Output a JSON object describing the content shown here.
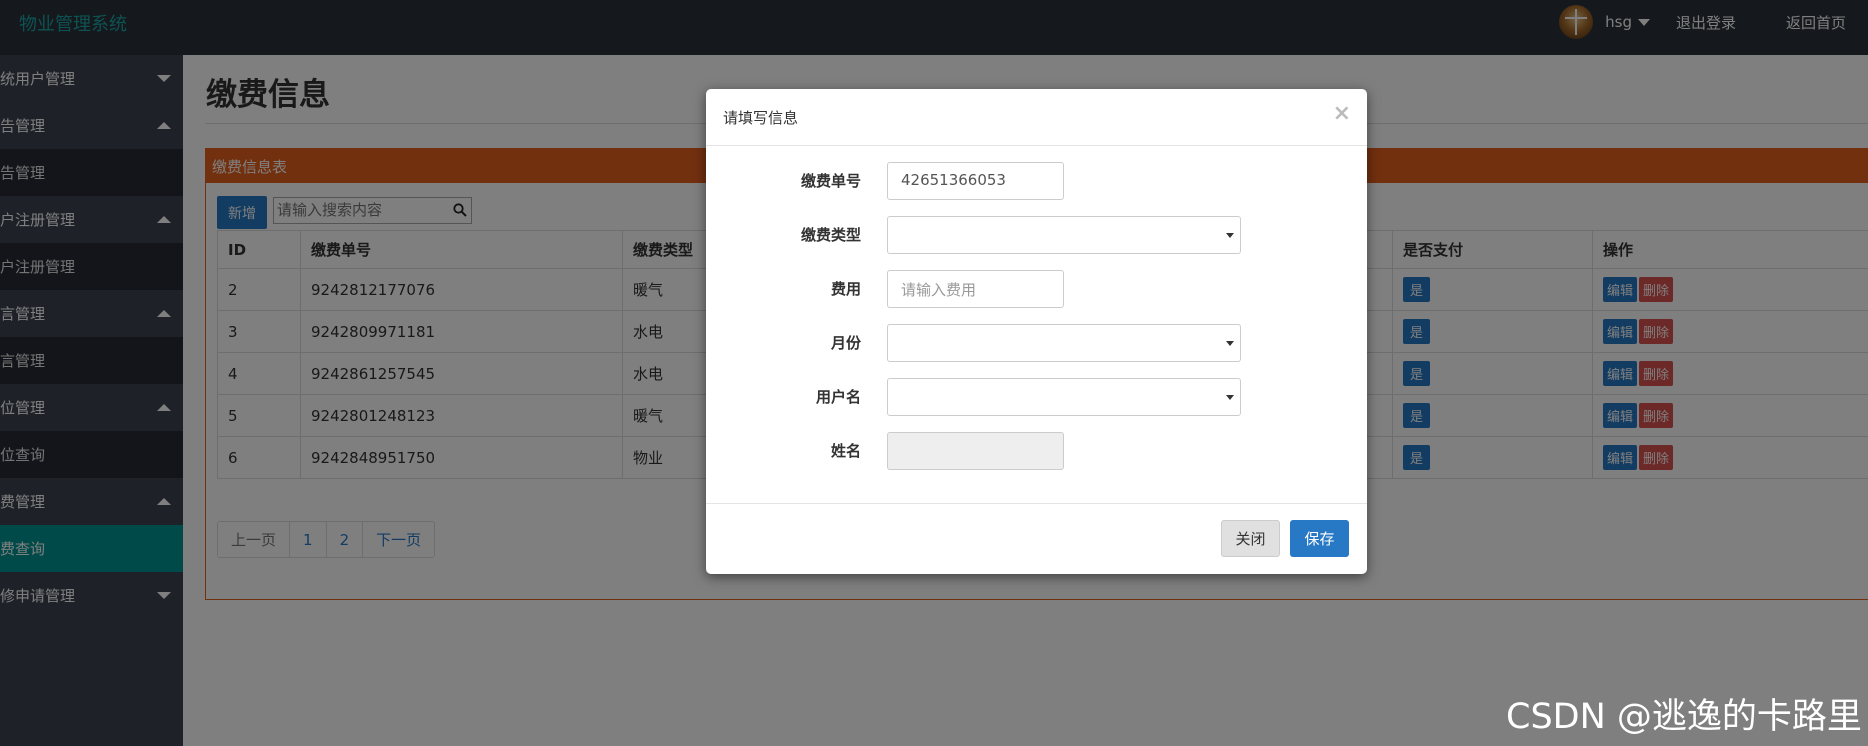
{
  "app": {
    "brand": "物业管理系统"
  },
  "topbar": {
    "username": "hsg",
    "logout": "退出登录",
    "home": "返回首页"
  },
  "sidebar": {
    "items": [
      {
        "label": "统用户管理",
        "type": "head",
        "expanded": false
      },
      {
        "label": "告管理",
        "type": "head",
        "expanded": true
      },
      {
        "label": "告管理",
        "type": "sub"
      },
      {
        "label": "户注册管理",
        "type": "head",
        "expanded": true
      },
      {
        "label": "户注册管理",
        "type": "sub"
      },
      {
        "label": "言管理",
        "type": "head",
        "expanded": true
      },
      {
        "label": "言管理",
        "type": "sub"
      },
      {
        "label": "位管理",
        "type": "head",
        "expanded": true
      },
      {
        "label": "位查询",
        "type": "sub"
      },
      {
        "label": "费管理",
        "type": "head",
        "expanded": true
      },
      {
        "label": "费查询",
        "type": "sub",
        "active": true
      },
      {
        "label": "修申请管理",
        "type": "head",
        "expanded": false
      }
    ]
  },
  "main": {
    "title": "缴费信息",
    "panel_title": "缴费信息表",
    "new_button": "新增",
    "search_placeholder": "请输入搜索内容",
    "columns": [
      "ID",
      "缴费单号",
      "缴费类型",
      "是否支付",
      "操作"
    ],
    "rows": [
      {
        "id": "2",
        "no": "9242812177076",
        "type": "暖气",
        "paid": "是"
      },
      {
        "id": "3",
        "no": "9242809971181",
        "type": "水电",
        "paid": "是"
      },
      {
        "id": "4",
        "no": "9242861257545",
        "type": "水电",
        "paid": "是"
      },
      {
        "id": "5",
        "no": "9242801248123",
        "type": "暖气",
        "paid": "是"
      },
      {
        "id": "6",
        "no": "9242848951750",
        "type": "物业",
        "paid": "是"
      }
    ],
    "edit_label": "编辑",
    "delete_label": "删除",
    "pager": {
      "prev": "上一页",
      "p1": "1",
      "p2": "2",
      "next": "下一页"
    }
  },
  "modal": {
    "title": "请填写信息",
    "close_x": "×",
    "fields": {
      "no_label": "缴费单号",
      "no_value": "42651366053",
      "type_label": "缴费类型",
      "fee_label": "费用",
      "fee_placeholder": "请输入费用",
      "month_label": "月份",
      "user_label": "用户名",
      "name_label": "姓名"
    },
    "close_button": "关闭",
    "save_button": "保存"
  },
  "watermark": "CSDN @逃逸的卡路里"
}
